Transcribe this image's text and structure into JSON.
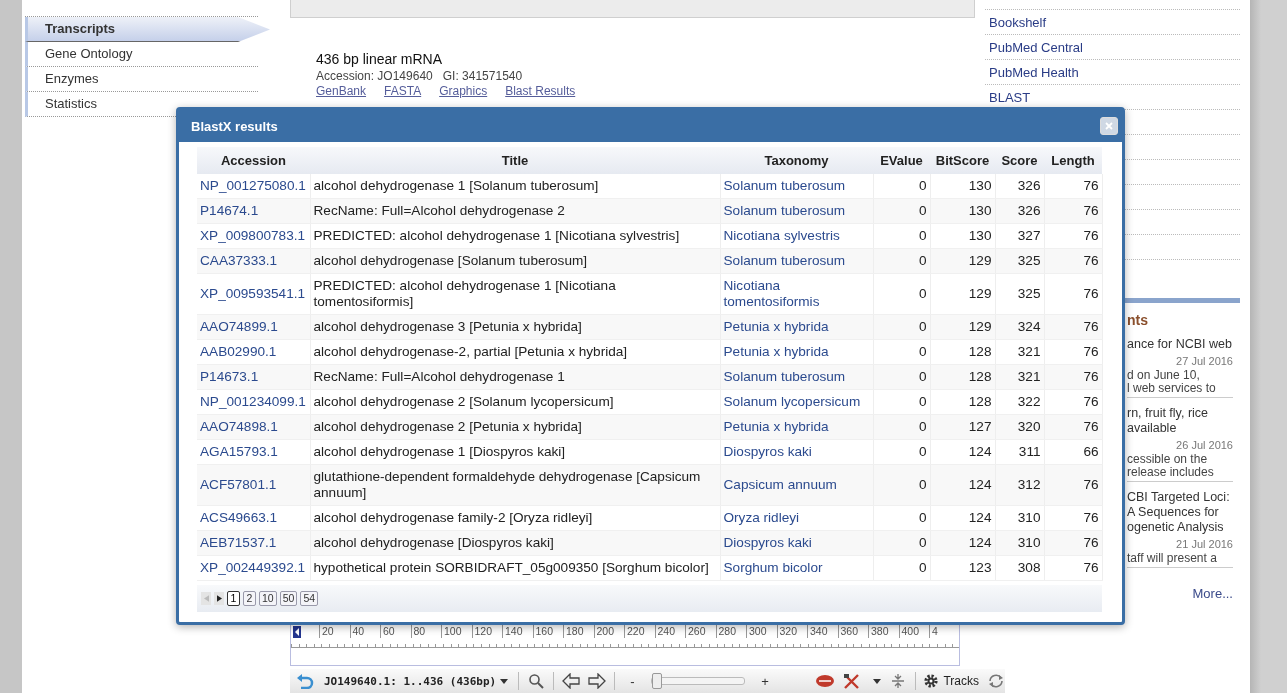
{
  "sidebar": {
    "items": [
      {
        "label": "Transcripts",
        "selected": true
      },
      {
        "label": "Gene Ontology",
        "selected": false
      },
      {
        "label": "Enzymes",
        "selected": false
      },
      {
        "label": "Statistics",
        "selected": false
      }
    ]
  },
  "record": {
    "summary": "436 bp linear mRNA",
    "accession": "Accession: JO149640",
    "gi": "GI: 341571540",
    "links": [
      "GenBank",
      "FASTA",
      "Graphics",
      "Blast Results"
    ]
  },
  "resources": {
    "links": [
      "Bookshelf",
      "PubMed Central",
      "PubMed Health",
      "BLAST"
    ]
  },
  "news": {
    "heading": "nts",
    "items": [
      {
        "lines": [
          "ance for NCBI web"
        ],
        "date": "27 Jul 2016",
        "summary": [
          "d on June 10,",
          "l web services to"
        ]
      },
      {
        "lines": [
          "rn, fruit fly, rice",
          "available"
        ],
        "date": "26 Jul 2016",
        "summary": [
          "cessible on the",
          "release includes"
        ]
      },
      {
        "lines": [
          "CBI Targeted Loci:",
          "A Sequences for",
          "ogenetic Analysis"
        ],
        "date": "21 Jul 2016",
        "summary": [
          "taff will present a"
        ]
      }
    ],
    "more": "More..."
  },
  "dialog": {
    "title": "BlastX results",
    "columns": [
      "Accession",
      "Title",
      "Taxonomy",
      "EValue",
      "BitScore",
      "Score",
      "Length"
    ],
    "rows": [
      {
        "accession": "NP_001275080.1",
        "title": "alcohol dehydrogenase 1 [Solanum tuberosum]",
        "taxonomy": "Solanum tuberosum",
        "evalue": "0",
        "bitscore": "130",
        "score": "326",
        "length": "76"
      },
      {
        "accession": "P14674.1",
        "title": "RecName: Full=Alcohol dehydrogenase 2",
        "taxonomy": "Solanum tuberosum",
        "evalue": "0",
        "bitscore": "130",
        "score": "326",
        "length": "76"
      },
      {
        "accession": "XP_009800783.1",
        "title": "PREDICTED: alcohol dehydrogenase 1 [Nicotiana sylvestris]",
        "taxonomy": "Nicotiana sylvestris",
        "evalue": "0",
        "bitscore": "130",
        "score": "327",
        "length": "76"
      },
      {
        "accession": "CAA37333.1",
        "title": "alcohol dehydrogenase [Solanum tuberosum]",
        "taxonomy": "Solanum tuberosum",
        "evalue": "0",
        "bitscore": "129",
        "score": "325",
        "length": "76"
      },
      {
        "accession": "XP_009593541.1",
        "title": "PREDICTED: alcohol dehydrogenase 1 [Nicotiana tomentosiformis]",
        "taxonomy": "Nicotiana tomentosiformis",
        "evalue": "0",
        "bitscore": "129",
        "score": "325",
        "length": "76"
      },
      {
        "accession": "AAO74899.1",
        "title": "alcohol dehydrogenase 3 [Petunia x hybrida]",
        "taxonomy": "Petunia x hybrida",
        "evalue": "0",
        "bitscore": "129",
        "score": "324",
        "length": "76"
      },
      {
        "accession": "AAB02990.1",
        "title": "alcohol dehydrogenase-2, partial [Petunia x hybrida]",
        "taxonomy": "Petunia x hybrida",
        "evalue": "0",
        "bitscore": "128",
        "score": "321",
        "length": "76"
      },
      {
        "accession": "P14673.1",
        "title": "RecName: Full=Alcohol dehydrogenase 1",
        "taxonomy": "Solanum tuberosum",
        "evalue": "0",
        "bitscore": "128",
        "score": "321",
        "length": "76"
      },
      {
        "accession": "NP_001234099.1",
        "title": "alcohol dehydrogenase 2 [Solanum lycopersicum]",
        "taxonomy": "Solanum lycopersicum",
        "evalue": "0",
        "bitscore": "128",
        "score": "322",
        "length": "76"
      },
      {
        "accession": "AAO74898.1",
        "title": "alcohol dehydrogenase 2 [Petunia x hybrida]",
        "taxonomy": "Petunia x hybrida",
        "evalue": "0",
        "bitscore": "127",
        "score": "320",
        "length": "76"
      },
      {
        "accession": "AGA15793.1",
        "title": "alcohol dehydrogenase 1 [Diospyros kaki]",
        "taxonomy": "Diospyros kaki",
        "evalue": "0",
        "bitscore": "124",
        "score": "311",
        "length": "66"
      },
      {
        "accession": "ACF57801.1",
        "title": "glutathione-dependent formaldehyde dehydrogenase [Capsicum annuum]",
        "taxonomy": "Capsicum annuum",
        "evalue": "0",
        "bitscore": "124",
        "score": "312",
        "length": "76"
      },
      {
        "accession": "ACS49663.1",
        "title": "alcohol dehydrogenase family-2 [Oryza ridleyi]",
        "taxonomy": "Oryza ridleyi",
        "evalue": "0",
        "bitscore": "124",
        "score": "310",
        "length": "76"
      },
      {
        "accession": "AEB71537.1",
        "title": "alcohol dehydrogenase [Diospyros kaki]",
        "taxonomy": "Diospyros kaki",
        "evalue": "0",
        "bitscore": "124",
        "score": "310",
        "length": "76"
      },
      {
        "accession": "XP_002449392.1",
        "title": "hypothetical protein SORBIDRAFT_05g009350 [Sorghum bicolor]",
        "taxonomy": "Sorghum bicolor",
        "evalue": "0",
        "bitscore": "123",
        "score": "308",
        "length": "76"
      }
    ],
    "pager": {
      "prev_disabled": true,
      "next_disabled": false,
      "pages": [
        {
          "label": "1",
          "selected": true
        },
        {
          "label": "2",
          "selected": false
        },
        {
          "label": "10",
          "selected": false
        },
        {
          "label": "50",
          "selected": false
        },
        {
          "label": "54",
          "selected": false
        }
      ]
    }
  },
  "viewer": {
    "ruler_labels": [
      "20",
      "40",
      "60",
      "80",
      "100",
      "120",
      "140",
      "160",
      "180",
      "200",
      "220",
      "240",
      "260",
      "280",
      "300",
      "320",
      "340",
      "360",
      "380",
      "400",
      "4"
    ],
    "location": "JO149640.1: 1..436 (436bp)",
    "zoom_out": "-",
    "zoom_in": "+",
    "zoom": {
      "level": 0.06
    },
    "tracks": "Tracks"
  }
}
